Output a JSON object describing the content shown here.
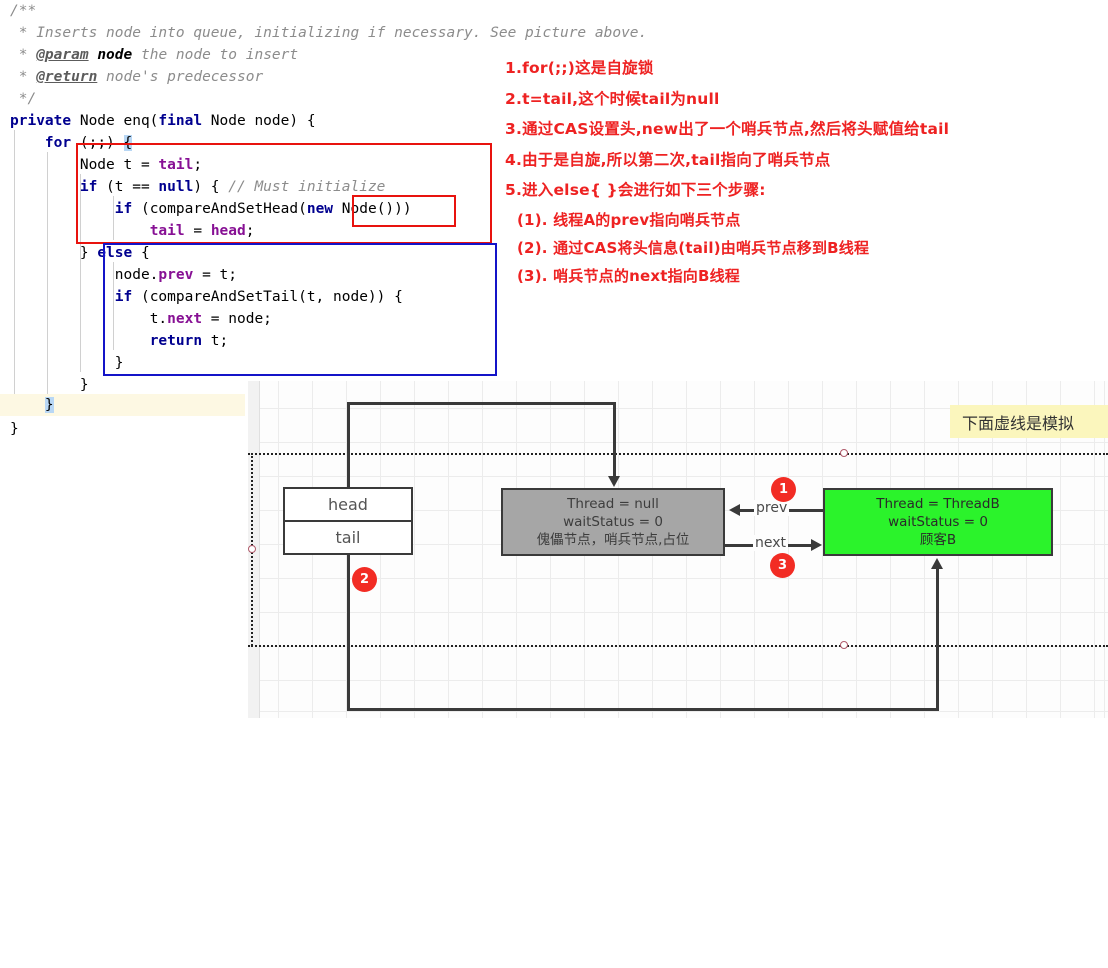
{
  "code": {
    "lines": [
      "/**",
      " * Inserts node into queue, initializing if necessary. See picture above.",
      " * @param node the node to insert",
      " * @return node's predecessor",
      " */",
      "private Node enq(final Node node) {",
      "    for (;;) {",
      "        Node t = tail;",
      "        if (t == null) { // Must initialize",
      "            if (compareAndSetHead(new Node()))",
      "                tail = head;",
      "        } else {",
      "            node.prev = t;",
      "            if (compareAndSetTail(t, node)) {",
      "                t.next = node;",
      "                return t;",
      "            }",
      "        }",
      "    }",
      "}"
    ],
    "comment_line1": "/**",
    "comment_line2": " * Inserts node into queue, initializing if necessary. See picture above.",
    "comment_line3_star": " * ",
    "comment_line3_tag": "@param",
    "comment_line3_bold": " node",
    "comment_line3_rest": " the node to insert",
    "comment_line4_star": " * ",
    "comment_line4_tag": "@return",
    "comment_line4_rest": " node's predecessor",
    "comment_line5": " */",
    "sig_private": "private",
    "sig_mid": " Node enq(",
    "sig_final": "final",
    "sig_rest": " Node node) {",
    "for_kw": "for",
    "for_rest": " (;;) ",
    "for_brace": "{",
    "l_node_t": "Node t = ",
    "l_tail_fld": "tail",
    "l_semi": ";",
    "l_if": "if",
    "l_if_a": " (t == ",
    "l_null": "null",
    "l_if_b": ") { ",
    "l_if_cmt": "// Must initialize",
    "l_if2": "if",
    "l_if2_a": " (compareAndSetHead(",
    "l_new": "new",
    "l_new_a": " Node()",
    "l_if2_b": "))",
    "l_tailhead_a": "tail",
    "l_tailhead_b": " = ",
    "l_tailhead_c": "head",
    "l_tailhead_d": ";",
    "l_else_close": "} ",
    "l_else": "else",
    "l_else_brace": " {",
    "l_nodeprev_a": "node.",
    "l_nodeprev_b": "prev",
    "l_nodeprev_c": " = t;",
    "l_if3": "if",
    "l_if3_a": " (compareAndSetTail(t, node)) {",
    "l_tnext_a": "t.",
    "l_tnext_b": "next",
    "l_tnext_c": " = node;",
    "l_return": "return",
    "l_return_a": " t;",
    "brace_close": "}"
  },
  "annotations": {
    "items": [
      "1.for(;;)这是自旋锁",
      "2.t=tail,这个时候tail为null",
      "3.通过CAS设置头,new出了一个哨兵节点,然后将头赋值给tail",
      "4.由于是自旋,所以第二次,tail指向了哨兵节点",
      "5.进入else{ }会进行如下三个步骤:"
    ],
    "subitems": [
      "(1). 线程A的prev指向哨兵节点",
      "(2). 通过CAS将头信息(tail)由哨兵节点移到B线程",
      "(3). 哨兵节点的next指向B线程"
    ],
    "color": "#ee2222"
  },
  "diagram": {
    "head_label": "head",
    "tail_label": "tail",
    "sentinel": {
      "line1": "Thread = null",
      "line2": "waitStatus = 0",
      "line3": "傀儡节点，哨兵节点,占位",
      "fill": "#a6a6a6"
    },
    "threadb": {
      "line1": "Thread = ThreadB",
      "line2": "waitStatus = 0",
      "line3": "顾客B",
      "fill": "#2bf32b"
    },
    "edge_prev": "prev",
    "edge_next": "next",
    "badges": [
      "1",
      "2",
      "3"
    ],
    "badge_color": "#f22c24",
    "note": "下面虚线是模拟",
    "note_color": "#fbf6bd"
  }
}
